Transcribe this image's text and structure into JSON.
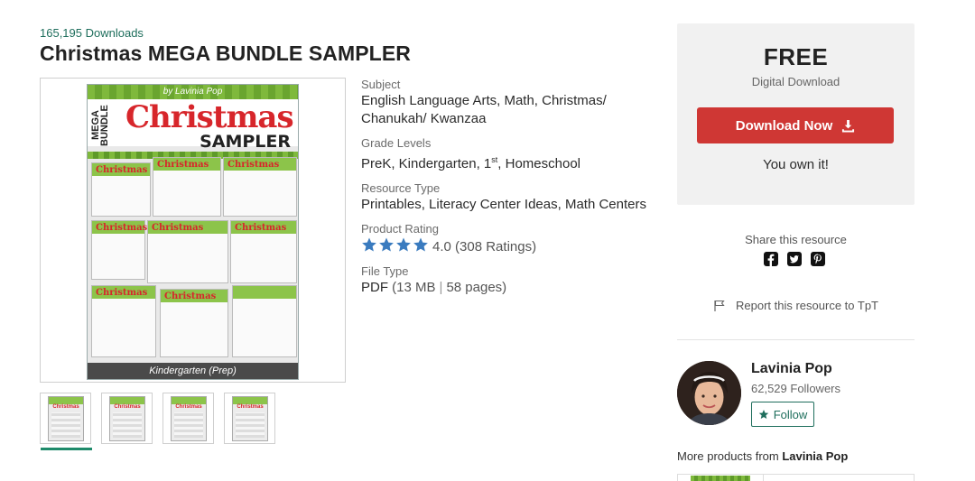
{
  "product": {
    "downloads": "165,195 Downloads",
    "title": "Christmas MEGA BUNDLE SAMPLER"
  },
  "cover": {
    "byline": "by Lavinia Pop",
    "mega": "MEGA BUNDLE",
    "headline": "Christmas",
    "sampler": "SAMPLER",
    "grade": "Kindergarten (Prep)",
    "page_titles": [
      "Christmas",
      "Christmas",
      "Christmas",
      "Christmas",
      "Christmas",
      "Christmas",
      "Christmas",
      "Christmas"
    ]
  },
  "thumbnails": [
    {
      "label": "Christmas"
    },
    {
      "label": "Christmas"
    },
    {
      "label": "Christmas"
    },
    {
      "label": "Christmas"
    }
  ],
  "meta": {
    "subject_label": "Subject",
    "subject_value": "English Language Arts, Math, Christmas/ Chanukah/ Kwanzaa",
    "grade_label": "Grade Levels",
    "grade_value_pre": "PreK, Kindergarten, 1",
    "grade_value_sup": "st",
    "grade_value_post": ", Homeschool",
    "type_label": "Resource Type",
    "type_value": "Printables, Literacy Center Ideas, Math Centers",
    "rating_label": "Product Rating",
    "rating_value": "4.0",
    "rating_count": "(308 Ratings)",
    "rating_stars": 4,
    "file_label": "File Type",
    "file_format": "PDF",
    "file_size": "(13 MB",
    "file_sep": "|",
    "file_pages": "58 pages)"
  },
  "purchase": {
    "price": "FREE",
    "price_sub": "Digital Download",
    "button_label": "Download Now",
    "owned_text": "You own it!"
  },
  "share": {
    "label": "Share this resource",
    "icons": [
      "facebook-icon",
      "twitter-icon",
      "pinterest-icon"
    ]
  },
  "report": {
    "label": "Report this resource to TpT"
  },
  "author": {
    "name": "Lavinia Pop",
    "followers": "62,529 Followers",
    "follow_label": "Follow"
  },
  "more": {
    "prefix": "More products from",
    "author": "Lavinia Pop"
  },
  "colors": {
    "accent_green": "#1e6e5c",
    "button_red": "#cf3734",
    "star_blue": "#3a7bbf",
    "panel_grey": "#f1f1f1"
  }
}
